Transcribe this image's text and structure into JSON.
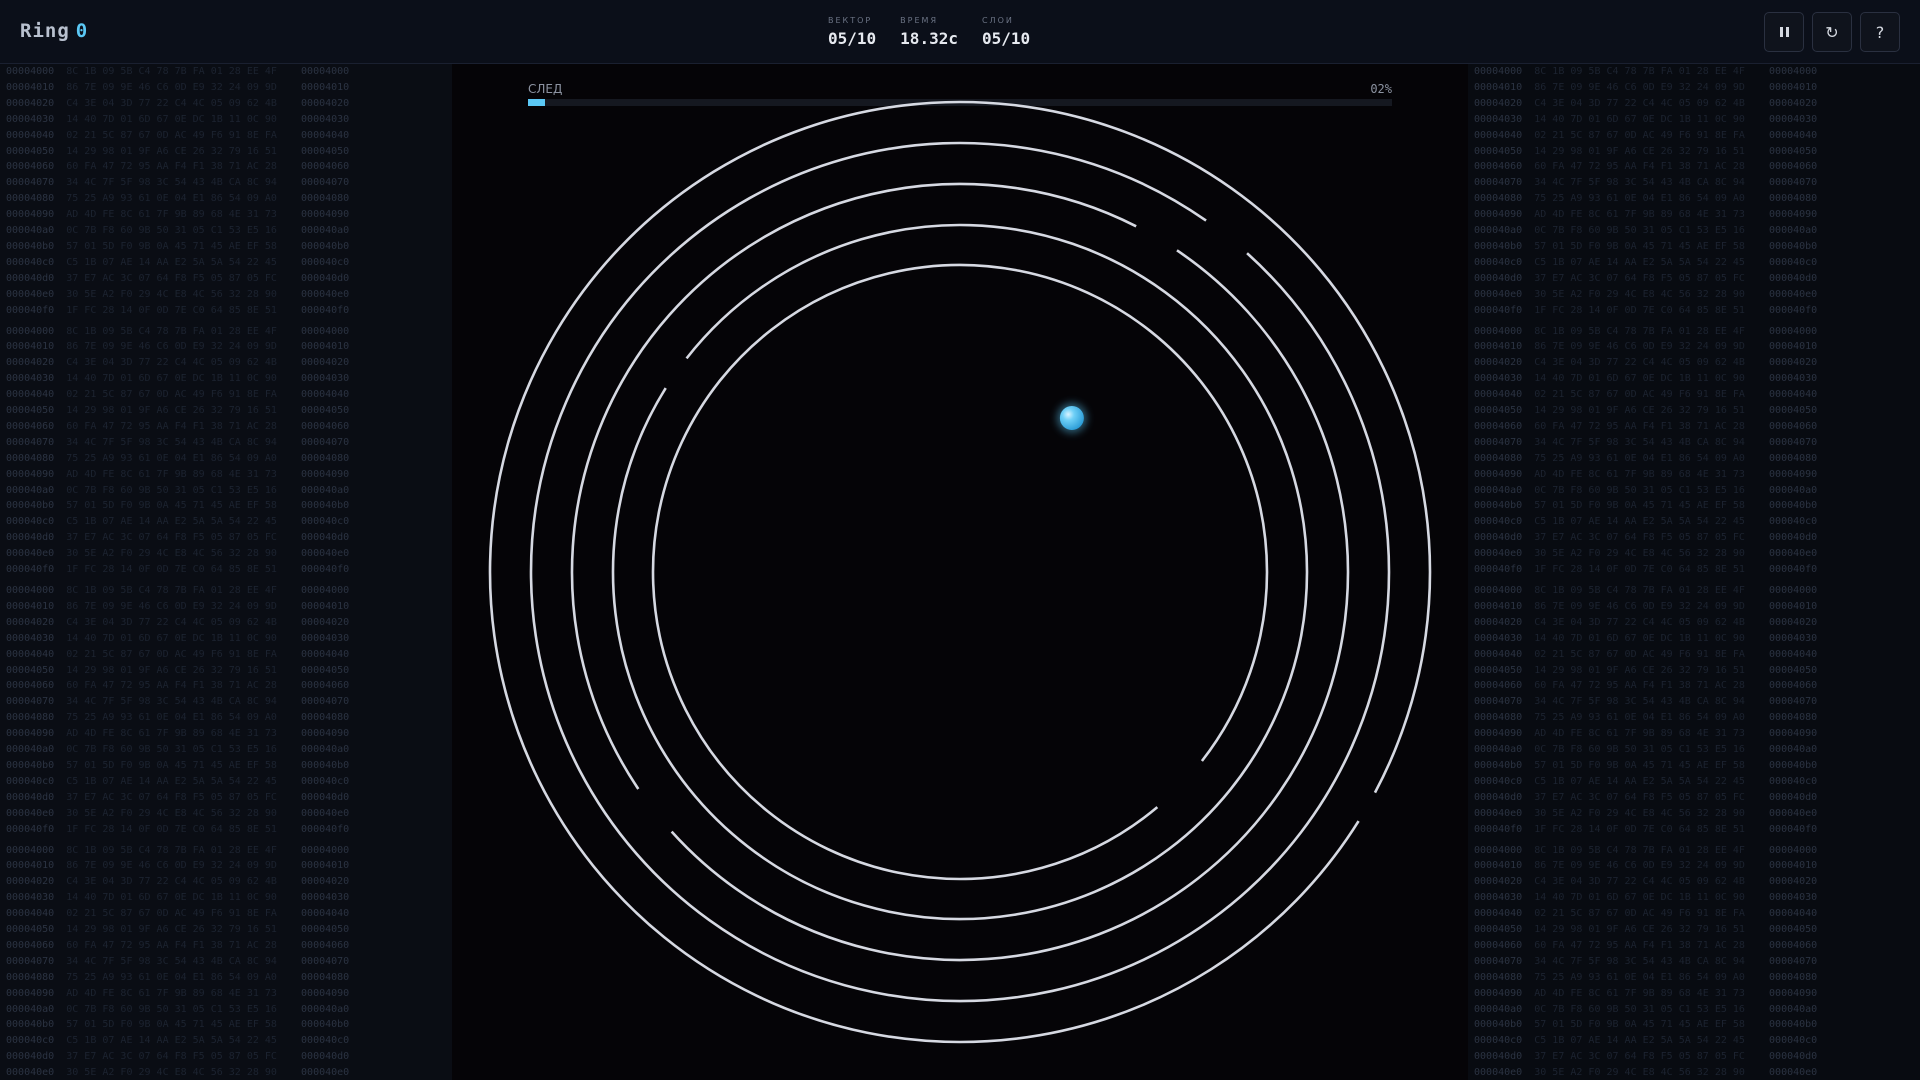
{
  "app": {
    "title": "Ring",
    "level": "0"
  },
  "stats": [
    {
      "label": "ВЕКТОР",
      "value": "05/10"
    },
    {
      "label": "ВРЕМЯ",
      "value": "18.32с"
    },
    {
      "label": "СЛОИ",
      "value": "05/10"
    }
  ],
  "controls": [
    {
      "name": "pause-button",
      "icon": "pause-icon",
      "glyph": ""
    },
    {
      "name": "restart-button",
      "icon": "refresh-icon",
      "glyph": "↻"
    },
    {
      "name": "help-button",
      "icon": "help-icon",
      "glyph": "?"
    }
  ],
  "trace": {
    "label": "СЛЕД",
    "percent": "02%",
    "progress": 0.02
  },
  "colors": {
    "accent": "#5bc8f5",
    "ring": "#d6d9e2",
    "background": "#050407"
  },
  "hex_dump": {
    "addresses": [
      "00004000",
      "00004010",
      "00004020",
      "00004030",
      "00004040",
      "00004050",
      "00004060",
      "00004070",
      "00004080",
      "00004090",
      "000040a0",
      "000040b0",
      "000040c0",
      "000040d0",
      "000040e0",
      "000040f0"
    ],
    "bytes": [
      "8C 1B 09 5B C4 78 7B FA 01 28 EE 4F",
      "86 7E 09 9E 46 C6 0D E9 32 24 09 9D",
      "C4 3E 04 3D 77 22 C4 4C 05 09 62 4B",
      "14 40 7D 01 6D 67 0E DC 1B 11 0C 90",
      "02 21 5C 87 67 0D AC 49 F6 91 8E FA",
      "14 29 98 01 9F A6 CE 26 32 79 16 51",
      "60 FA 47 72 95 AA F4 F1 38 71 AC 28",
      "34 4C 7F 5F 98 3C 54 43 4B CA 8C 94",
      "75 25 A9 93 61 0E 04 E1 86 54 09 A0",
      "AD 4D FE 8C 61 7F 9B 89 68 4E 31 73",
      "0C 7B F8 60 9B 50 31 05 C1 53 E5 16",
      "57 01 5D F0 9B 0A 45 71 45 AE EF 58",
      "C5 1B 07 AE 14 AA E2 5A 5A 54 22 45",
      "37 E7 AC 3C 07 64 F8 F5 05 87 05 FC",
      "30 5E A2 F0 29 4C E8 4C 56 32 28 90",
      "1F FC 28 14 0F 0D 7E C0 64 85 8E 51"
    ]
  },
  "ring": {
    "layers": 5,
    "arcs": [
      {
        "layer": 1,
        "start_deg": 0,
        "end_deg": 28
      },
      {
        "layer": 1,
        "start_deg": 32,
        "end_deg": 360
      },
      {
        "layer": 2,
        "start_deg": 0,
        "end_deg": 305
      },
      {
        "layer": 2,
        "start_deg": 312,
        "end_deg": 360
      },
      {
        "layer": 3,
        "start_deg": 0,
        "end_deg": 138
      },
      {
        "layer": 3,
        "start_deg": 146,
        "end_deg": 297
      },
      {
        "layer": 3,
        "start_deg": 304,
        "end_deg": 360
      },
      {
        "layer": 4,
        "start_deg": 0,
        "end_deg": 212
      },
      {
        "layer": 4,
        "start_deg": 218,
        "end_deg": 360
      },
      {
        "layer": 5,
        "start_deg": 0,
        "end_deg": 38
      },
      {
        "layer": 5,
        "start_deg": 50,
        "end_deg": 360
      }
    ]
  },
  "ball": {
    "angle_deg": 36,
    "radius_ratio": 0.62
  }
}
